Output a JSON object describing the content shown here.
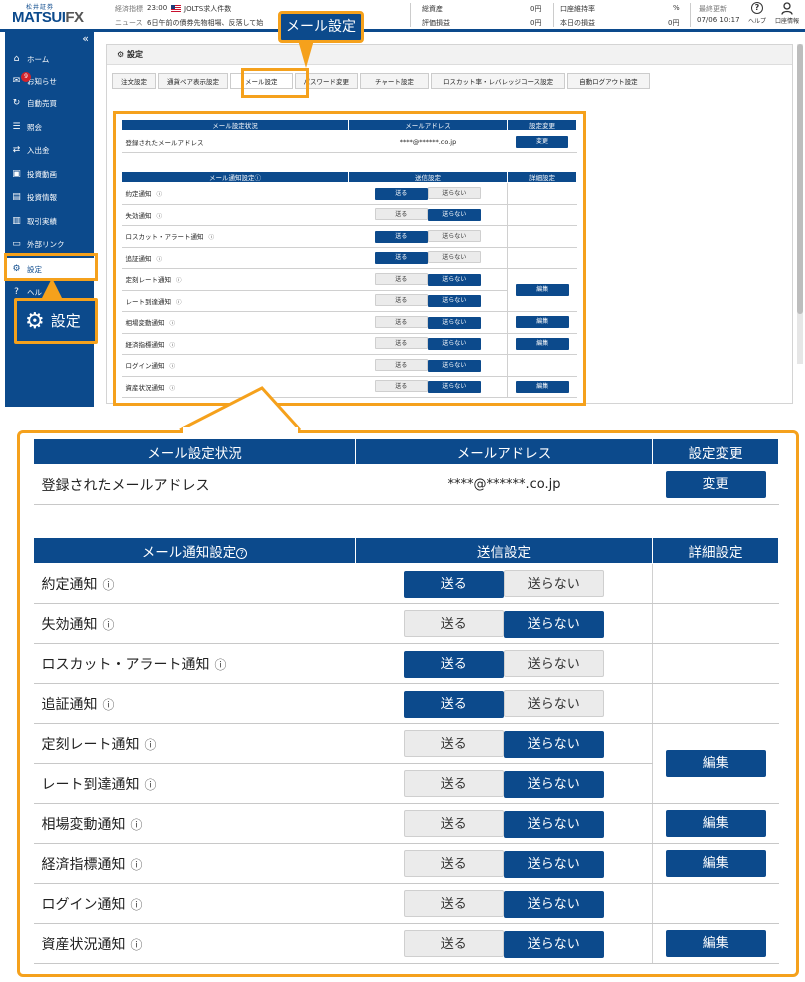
{
  "header": {
    "logo_small": "松井証券",
    "logo_main": "MATSUI",
    "logo_fx": "FX",
    "econ_label": "経済指標",
    "econ_time": "23:00",
    "econ_title": "JOLTS求人件数",
    "news_label": "ニュース",
    "news_text": "6日午前の債券先物相場、反落して始",
    "total_assets_label": "総資産",
    "total_assets_value": "0円",
    "unrealized_label": "評価損益",
    "unrealized_value": "0円",
    "margin_label": "口座維持率",
    "margin_value": "%",
    "today_pl_label": "本日の損益",
    "today_pl_value": "0円",
    "last_update_label": "最終更新",
    "last_update_value": "07/06 10:17",
    "help_label": "ヘルプ",
    "account_label": "口座情報"
  },
  "sidebar": {
    "collapse": "«",
    "items": [
      {
        "label": "ホーム",
        "icon": "home-icon"
      },
      {
        "label": "お知らせ",
        "icon": "mail-icon",
        "badge": "9"
      },
      {
        "label": "自動売買",
        "icon": "auto-icon"
      },
      {
        "label": "照会",
        "icon": "list-icon"
      },
      {
        "label": "入出金",
        "icon": "transfer-icon"
      },
      {
        "label": "投資動画",
        "icon": "video-icon"
      },
      {
        "label": "投資情報",
        "icon": "info-icon"
      },
      {
        "label": "取引実績",
        "icon": "record-icon"
      },
      {
        "label": "外部リンク",
        "icon": "link-icon"
      },
      {
        "label": "設定",
        "icon": "gear-icon"
      },
      {
        "label": "ヘル",
        "icon": "help-icon"
      }
    ]
  },
  "page": {
    "title": "設定",
    "tabs": [
      "注文設定",
      "通貨ペア表示設定",
      "メール設定",
      "パスワード変更",
      "チャート設定",
      "ロスカット率・レバレッジコース設定",
      "自動ログアウト設定"
    ],
    "active_tab": 2
  },
  "mail_status": {
    "col_status": "メール設定状況",
    "col_address": "メールアドレス",
    "col_change": "設定変更",
    "row_label": "登録されたメールアドレス",
    "address": "****@******.co.jp",
    "change_button": "変更"
  },
  "notify": {
    "col_setting": "メール通知設定",
    "col_send": "送信設定",
    "col_detail": "詳細設定",
    "send_label": "送る",
    "nosend_label": "送らない",
    "edit_label": "編集",
    "rows": [
      {
        "label": "約定通知",
        "send": true
      },
      {
        "label": "失効通知",
        "send": false
      },
      {
        "label": "ロスカット・アラート通知",
        "send": true
      },
      {
        "label": "追証通知",
        "send": true
      },
      {
        "label": "定刻レート通知",
        "send": false
      },
      {
        "label": "レート到達通知",
        "send": false
      },
      {
        "label": "相場変動通知",
        "send": false
      },
      {
        "label": "経済指標通知",
        "send": false
      },
      {
        "label": "ログイン通知",
        "send": false
      },
      {
        "label": "資産状況通知",
        "send": false
      }
    ]
  },
  "callouts": {
    "tab_callout": "メール設定",
    "settings_callout": "設定"
  },
  "colors": {
    "brand": "#0c4a8c",
    "accent": "#f5a11c",
    "badge": "#d3222a"
  }
}
